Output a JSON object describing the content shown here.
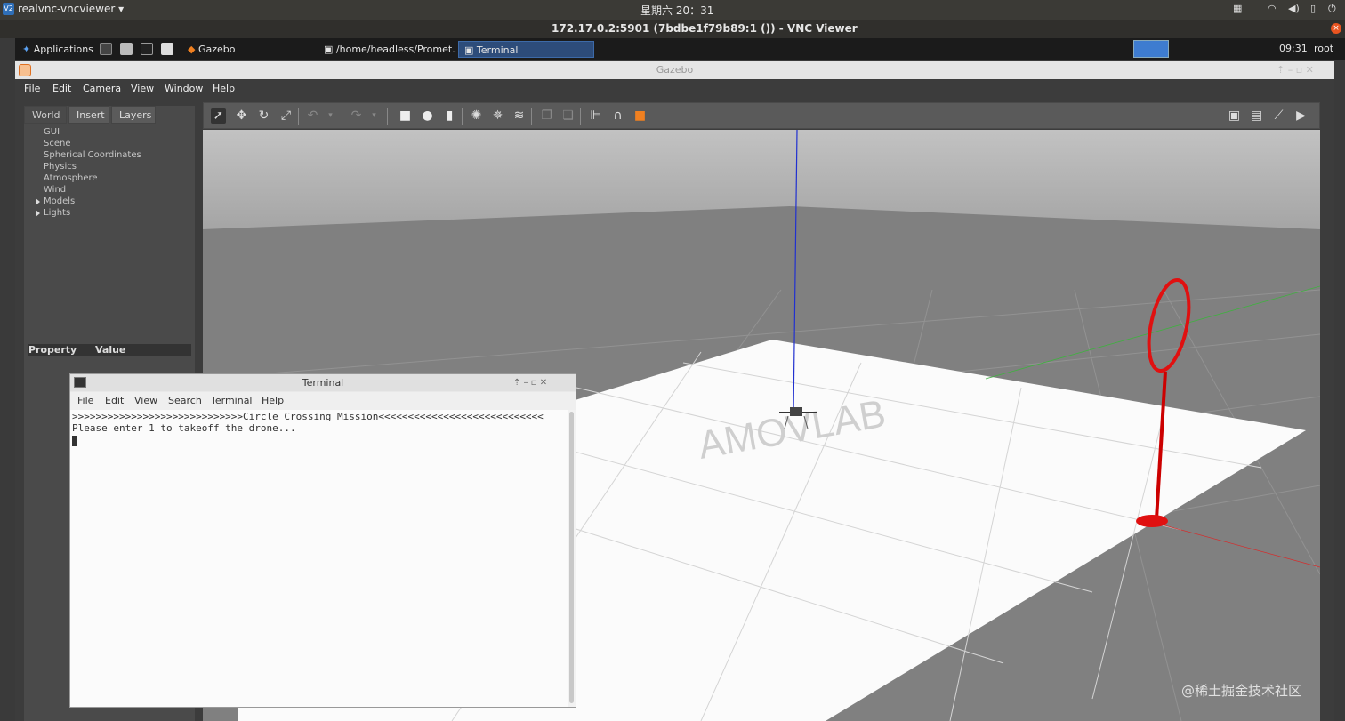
{
  "topbar": {
    "app_icon": "V2",
    "app_name": "realvnc-vncviewer",
    "clock": "星期六 20：31",
    "tray_icons": [
      "keyboard-icon",
      "wifi-icon",
      "volume-icon",
      "battery-icon",
      "power-icon"
    ]
  },
  "vnc": {
    "title": "172.17.0.2:5901 (7bdbe1f79b89:1 ()) - VNC Viewer"
  },
  "xfce_panel": {
    "applications_label": "Applications",
    "tasks": [
      {
        "label": "Gazebo"
      },
      {
        "label": "/home/headless/Promet..."
      },
      {
        "label": "Terminal"
      }
    ],
    "clock": "09:31",
    "user": "root"
  },
  "gazebo": {
    "window_title": "Gazebo",
    "menu": [
      "File",
      "Edit",
      "Camera",
      "View",
      "Window",
      "Help"
    ],
    "left_tabs": [
      "World",
      "Insert",
      "Layers"
    ],
    "world_items": [
      "GUI",
      "Scene",
      "Spherical Coordinates",
      "Physics",
      "Atmosphere",
      "Wind"
    ],
    "world_expandable": [
      "Models",
      "Lights"
    ],
    "property_header": "Property",
    "value_header": "Value",
    "colors": {
      "ring": "#e01010",
      "z_axis": "#2030d0",
      "ground": "#ffffff",
      "sky": "#a8a8a8"
    }
  },
  "terminal": {
    "title": "Terminal",
    "menu": [
      "File",
      "Edit",
      "View",
      "Search",
      "Terminal",
      "Help"
    ],
    "line1": ">>>>>>>>>>>>>>>>>>>>>>>>>>>>>Circle Crossing Mission<<<<<<<<<<<<<<<<<<<<<<<<<<<<",
    "line2": "Please enter 1 to takeoff the drone..."
  },
  "watermark": "@稀土掘金技术社区"
}
